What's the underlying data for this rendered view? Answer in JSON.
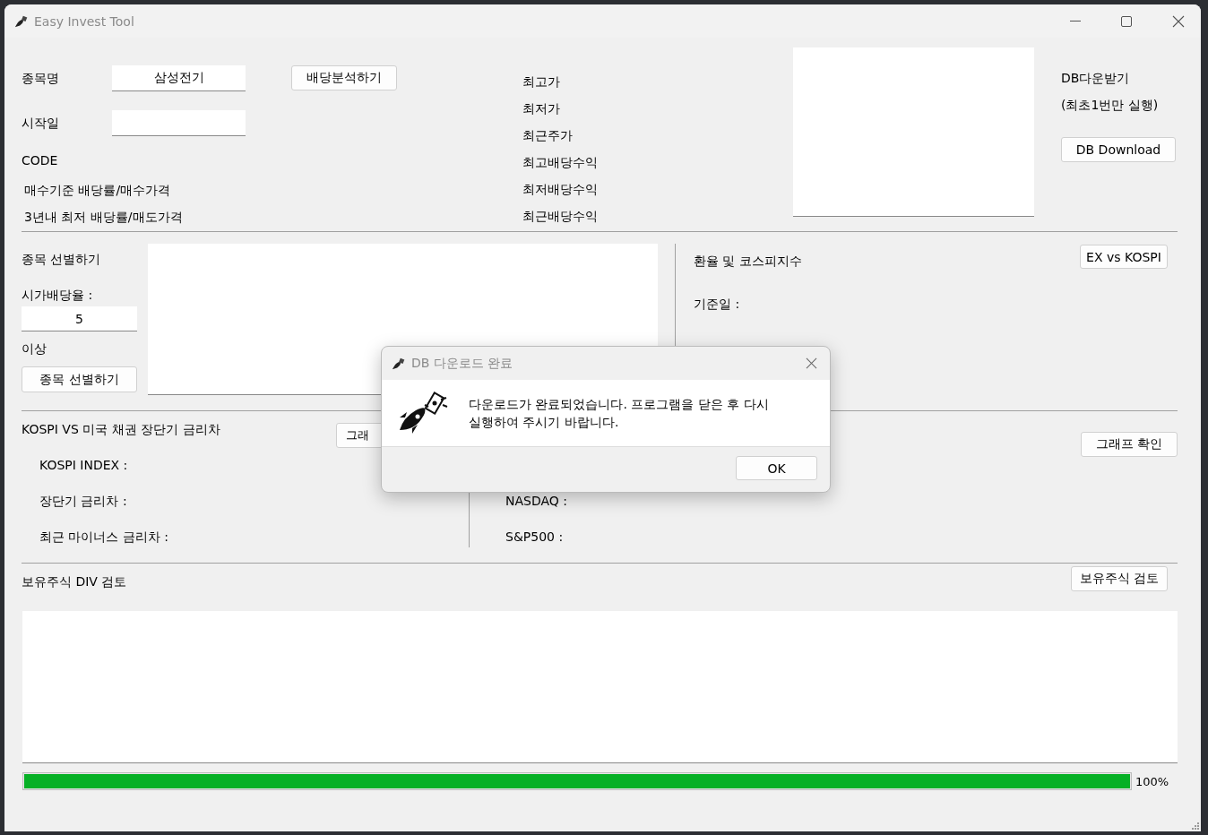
{
  "window": {
    "title": "Easy Invest Tool"
  },
  "stock_info": {
    "fields": [
      {
        "label": "종목명",
        "value": "삼성전기"
      },
      {
        "label": "시작일"
      }
    ],
    "code_label": "CODE",
    "rows": [
      "매수기준 배당률/매수가격",
      "3년내 최저 배당률/매도가격"
    ],
    "analyze_button": "배당분석하기",
    "stats": [
      "최고가",
      "최저가",
      "최근주가",
      "최고배당수익",
      "최저배당수익",
      "최근배당수익"
    ]
  },
  "db": {
    "title": "DB다운받기",
    "note": "(최초1번만 실행)",
    "button": "DB Download"
  },
  "screening": {
    "title": "종목 선별하기",
    "yield_label": "시가배당율 :",
    "yield_value": "5",
    "above_label": "이상",
    "button": "종목 선별하기"
  },
  "fx": {
    "title": "환율 및 코스피지수",
    "button": "EX vs KOSPI",
    "base_date_label": "기준일 :"
  },
  "spread": {
    "title": "KOSPI VS 미국 채권 장단기 금리차",
    "button": "그래",
    "labels": [
      "KOSPI INDEX :",
      "장단기 금리차 :",
      "최근 마이너스 금리차 :"
    ]
  },
  "us_index": {
    "button": "그래프 확인",
    "labels": [
      "NASDAQ :",
      "S&P500 :"
    ]
  },
  "holdings": {
    "title": "보유주식 DIV 검토",
    "button": "보유주식 검토"
  },
  "progress": {
    "level": 1,
    "reading": "100%"
  },
  "dialog": {
    "title": "DB 다운로드 완료",
    "message": "다운로드가 완료되었습니다. 프로그램을 닫은 후 다시 실행하여 주시기 바랍니다.",
    "button": "OK"
  }
}
